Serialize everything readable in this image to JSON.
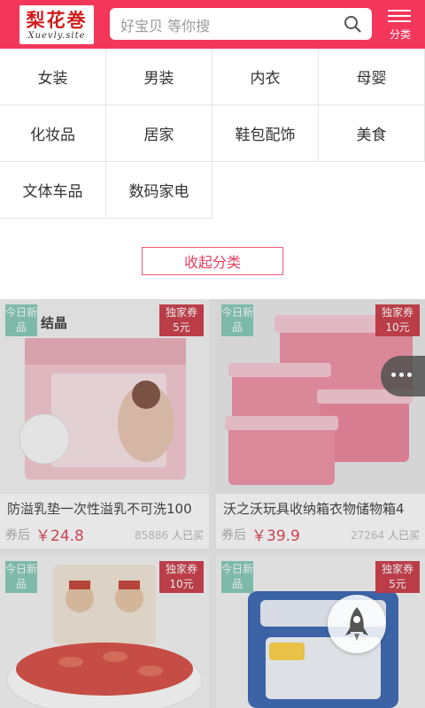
{
  "header": {
    "logo_title": "梨花巻",
    "logo_sub": "Xuevly.site",
    "search_placeholder": "好宝贝 等你搜",
    "menu_label": "分类",
    "bg_color": "#f4365a"
  },
  "categories": [
    "女装",
    "男装",
    "内衣",
    "母婴",
    "化妆品",
    "居家",
    "鞋包配饰",
    "美食",
    "文体车品",
    "数码家电"
  ],
  "collapse_label": "收起分类",
  "products": [
    {
      "tag_new": "今日新品",
      "tag_coupon": "独家券",
      "coupon_value": "5元",
      "brand": "结晶",
      "title": "防溢乳垫一次性溢乳不可洗100",
      "price_label": "券后",
      "price": "￥24.8",
      "sold": "85886",
      "sold_suffix": "人已买"
    },
    {
      "tag_new": "今日新品",
      "tag_coupon": "独家券",
      "coupon_value": "10元",
      "title": "沃之沃玩具收纳箱衣物储物箱4",
      "price_label": "券后",
      "price": "￥39.9",
      "sold": "27264",
      "sold_suffix": "人已买"
    },
    {
      "tag_new": "今日新品",
      "tag_coupon": "独家券",
      "coupon_value": "10元"
    },
    {
      "tag_new": "今日新品",
      "tag_coupon": "独家券",
      "coupon_value": "5元"
    }
  ],
  "icons": {
    "search": "search-icon",
    "menu": "menu-icon",
    "more": "more-dots-icon",
    "rocket": "rocket-icon"
  }
}
